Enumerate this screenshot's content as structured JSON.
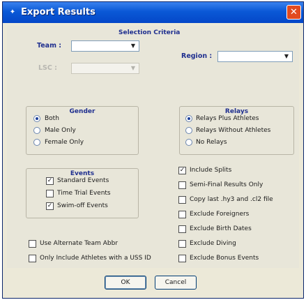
{
  "window": {
    "title": "Export Results",
    "close_icon": "close-icon",
    "app_icon": "app-icon"
  },
  "selection": {
    "heading": "Selection Criteria",
    "team_label": "Team :",
    "team_value": "",
    "lsc_label": "LSC :",
    "lsc_value": "",
    "region_label": "Region :",
    "region_value": ""
  },
  "gender": {
    "title": "Gender",
    "options": [
      "Both",
      "Male Only",
      "Female Only"
    ],
    "selected": "Both"
  },
  "relays": {
    "title": "Relays",
    "options": [
      "Relays Plus Athletes",
      "Relays Without Athletes",
      "No Relays"
    ],
    "selected": "Relays Plus Athletes"
  },
  "events": {
    "title": "Events",
    "items": [
      {
        "label": "Standard Events",
        "checked": true
      },
      {
        "label": "Time Trial Events",
        "checked": false
      },
      {
        "label": "Swim-off Events",
        "checked": true
      }
    ]
  },
  "right_options": [
    {
      "label": "Include Splits",
      "checked": true
    },
    {
      "label": "Semi-Final Results Only",
      "checked": false
    },
    {
      "label": "Copy last .hy3 and .cl2 file",
      "checked": false
    },
    {
      "label": "Exclude Foreigners",
      "checked": false
    },
    {
      "label": "Exclude Birth Dates",
      "checked": false
    },
    {
      "label": "Exclude Diving",
      "checked": false
    },
    {
      "label": "Exclude Bonus Events",
      "checked": false
    }
  ],
  "left_options": [
    {
      "label": "Use Alternate Team Abbr",
      "checked": false
    },
    {
      "label": "Only Include Athletes with a USS ID",
      "checked": false
    }
  ],
  "buttons": {
    "ok": "OK",
    "cancel": "Cancel"
  },
  "colors": {
    "title_bar": "#0a58d6",
    "heading": "#1f2f8f",
    "close": "#e24a1f",
    "background": "#e8e6d9"
  }
}
